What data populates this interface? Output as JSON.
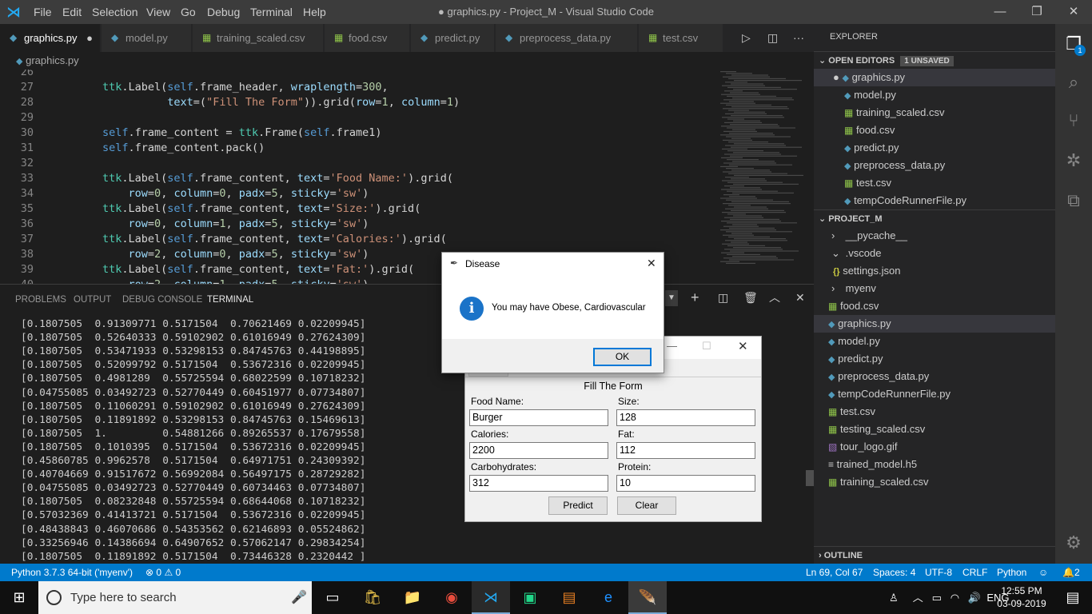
{
  "window": {
    "title": "● graphics.py - Project_M - Visual Studio Code",
    "menu": [
      "File",
      "Edit",
      "Selection",
      "View",
      "Go",
      "Debug",
      "Terminal",
      "Help"
    ]
  },
  "tabs": [
    {
      "label": "graphics.py",
      "type": "py",
      "active": true,
      "dirty": true
    },
    {
      "label": "model.py",
      "type": "py"
    },
    {
      "label": "training_scaled.csv",
      "type": "csv"
    },
    {
      "label": "food.csv",
      "type": "csv"
    },
    {
      "label": "predict.py",
      "type": "py"
    },
    {
      "label": "preprocess_data.py",
      "type": "py"
    },
    {
      "label": "test.csv",
      "type": "csv"
    }
  ],
  "breadcrumb": "graphics.py",
  "editor": {
    "lines": [
      {
        "n": "26",
        "t": ""
      },
      {
        "n": "27",
        "t": "ttk.Label(self.frame_header, wraplength=300,"
      },
      {
        "n": "28",
        "t": "          text=(\"Fill The Form\")).grid(row=1, column=1)"
      },
      {
        "n": "29",
        "t": ""
      },
      {
        "n": "30",
        "t": "self.frame_content = ttk.Frame(self.frame1)"
      },
      {
        "n": "31",
        "t": "self.frame_content.pack()"
      },
      {
        "n": "32",
        "t": ""
      },
      {
        "n": "33",
        "t": "ttk.Label(self.frame_content, text='Food Name:').grid("
      },
      {
        "n": "34",
        "t": "    row=0, column=0, padx=5, sticky='sw')"
      },
      {
        "n": "35",
        "t": "ttk.Label(self.frame_content, text='Size:').grid("
      },
      {
        "n": "36",
        "t": "    row=0, column=1, padx=5, sticky='sw')"
      },
      {
        "n": "37",
        "t": "ttk.Label(self.frame_content, text='Calories:').grid("
      },
      {
        "n": "38",
        "t": "    row=2, column=0, padx=5, sticky='sw')"
      },
      {
        "n": "39",
        "t": "ttk.Label(self.frame_content, text='Fat:').grid("
      },
      {
        "n": "40",
        "t": "    row=2, column=1, padx=5, sticky='sw')"
      }
    ]
  },
  "panel": {
    "tabs": [
      "PROBLEMS",
      "OUTPUT",
      "DEBUG CONSOLE",
      "TERMINAL"
    ],
    "active": "TERMINAL"
  },
  "terminal": [
    "[0.1807505  0.91309771 0.5171504  0.70621469 0.02209945]",
    "[0.1807505  0.52640333 0.59102902 0.61016949 0.27624309]",
    "[0.1807505  0.53471933 0.53298153 0.84745763 0.44198895]",
    "[0.1807505  0.52099792 0.5171504  0.53672316 0.02209945]",
    "[0.1807505  0.4981289  0.55725594 0.68022599 0.10718232]",
    "[0.04755085 0.03492723 0.52770449 0.60451977 0.07734807]",
    "[0.1807505  0.11060291 0.59102902 0.61016949 0.27624309]",
    "[0.1807505  0.11891892 0.53298153 0.84745763 0.15469613]",
    "[0.1807505  1.         0.54881266 0.89265537 0.17679558]",
    "[0.1807505  0.1010395  0.5171504  0.53672316 0.02209945]",
    "[0.45860785 0.9962578  0.5171504  0.64971751 0.24309392]",
    "[0.40704669 0.91517672 0.56992084 0.56497175 0.28729282]",
    "[0.04755085 0.03492723 0.52770449 0.60734463 0.07734807]",
    "[0.1807505  0.08232848 0.55725594 0.68644068 0.10718232]",
    "[0.57032369 0.41413721 0.5171504  0.53672316 0.02209945]",
    "[0.48438843 0.46070686 0.54353562 0.62146893 0.05524862]",
    "[0.33256946 0.14386694 0.64907652 0.57062147 0.29834254]",
    "[0.1807505  0.11891892 0.5171504  0.73446328 0.2320442 ]"
  ],
  "sidebar": {
    "explorer": "EXPLORER",
    "open_editors": "OPEN EDITORS",
    "unsaved": "1 UNSAVED",
    "open_files": [
      {
        "label": "graphics.py",
        "type": "py",
        "dirty": true
      },
      {
        "label": "model.py",
        "type": "py"
      },
      {
        "label": "training_scaled.csv",
        "type": "csv"
      },
      {
        "label": "food.csv",
        "type": "csv"
      },
      {
        "label": "predict.py",
        "type": "py"
      },
      {
        "label": "preprocess_data.py",
        "type": "py"
      },
      {
        "label": "test.csv",
        "type": "csv"
      },
      {
        "label": "tempCodeRunnerFile.py",
        "type": "py"
      }
    ],
    "project": "PROJECT_M",
    "tree": [
      {
        "label": "__pycache__",
        "type": "folder",
        "indent": 1,
        "chev": "›"
      },
      {
        "label": ".vscode",
        "type": "folder",
        "indent": 1,
        "chev": "⌄"
      },
      {
        "label": "settings.json",
        "type": "json",
        "indent": 2
      },
      {
        "label": "myenv",
        "type": "folder",
        "indent": 1,
        "chev": "›"
      },
      {
        "label": "food.csv",
        "type": "csv",
        "indent": 1
      },
      {
        "label": "graphics.py",
        "type": "py",
        "indent": 1,
        "sel": true
      },
      {
        "label": "model.py",
        "type": "py",
        "indent": 1
      },
      {
        "label": "predict.py",
        "type": "py",
        "indent": 1
      },
      {
        "label": "preprocess_data.py",
        "type": "py",
        "indent": 1
      },
      {
        "label": "tempCodeRunnerFile.py",
        "type": "py",
        "indent": 1
      },
      {
        "label": "test.csv",
        "type": "csv",
        "indent": 1
      },
      {
        "label": "testing_scaled.csv",
        "type": "csv",
        "indent": 1
      },
      {
        "label": "tour_logo.gif",
        "type": "gif",
        "indent": 1
      },
      {
        "label": "trained_model.h5",
        "type": "h5",
        "indent": 1
      },
      {
        "label": "training_scaled.csv",
        "type": "csv",
        "indent": 1
      }
    ],
    "outline": "OUTLINE"
  },
  "status": {
    "interpreter": "Python 3.7.3 64-bit ('myenv')",
    "errors": "0",
    "warnings": "0",
    "position": "Ln 69, Col 67",
    "spaces": "Spaces: 4",
    "encoding": "UTF-8",
    "eol": "CRLF",
    "language": "Python",
    "notifications": "2"
  },
  "taskbar": {
    "search_placeholder": "Type here to search",
    "time": "12:55 PM",
    "date": "03-09-2019"
  },
  "form": {
    "title": "Fill The Form",
    "food_name_label": "Food Name:",
    "food_name": "Burger",
    "size_label": "Size:",
    "size": "128",
    "calories_label": "Calories:",
    "calories": "2200",
    "fat_label": "Fat:",
    "fat": "112",
    "carbs_label": "Carbohydrates:",
    "carbs": "312",
    "protein_label": "Protein:",
    "protein": "10",
    "predict": "Predict",
    "clear": "Clear",
    "menu": "File"
  },
  "dialog": {
    "title": "Disease",
    "message": "You may have Obese, Cardiovascular",
    "ok": "OK"
  },
  "colors": {
    "accent": "#007acc",
    "py": "#519aba",
    "csv": "#8dc149"
  }
}
